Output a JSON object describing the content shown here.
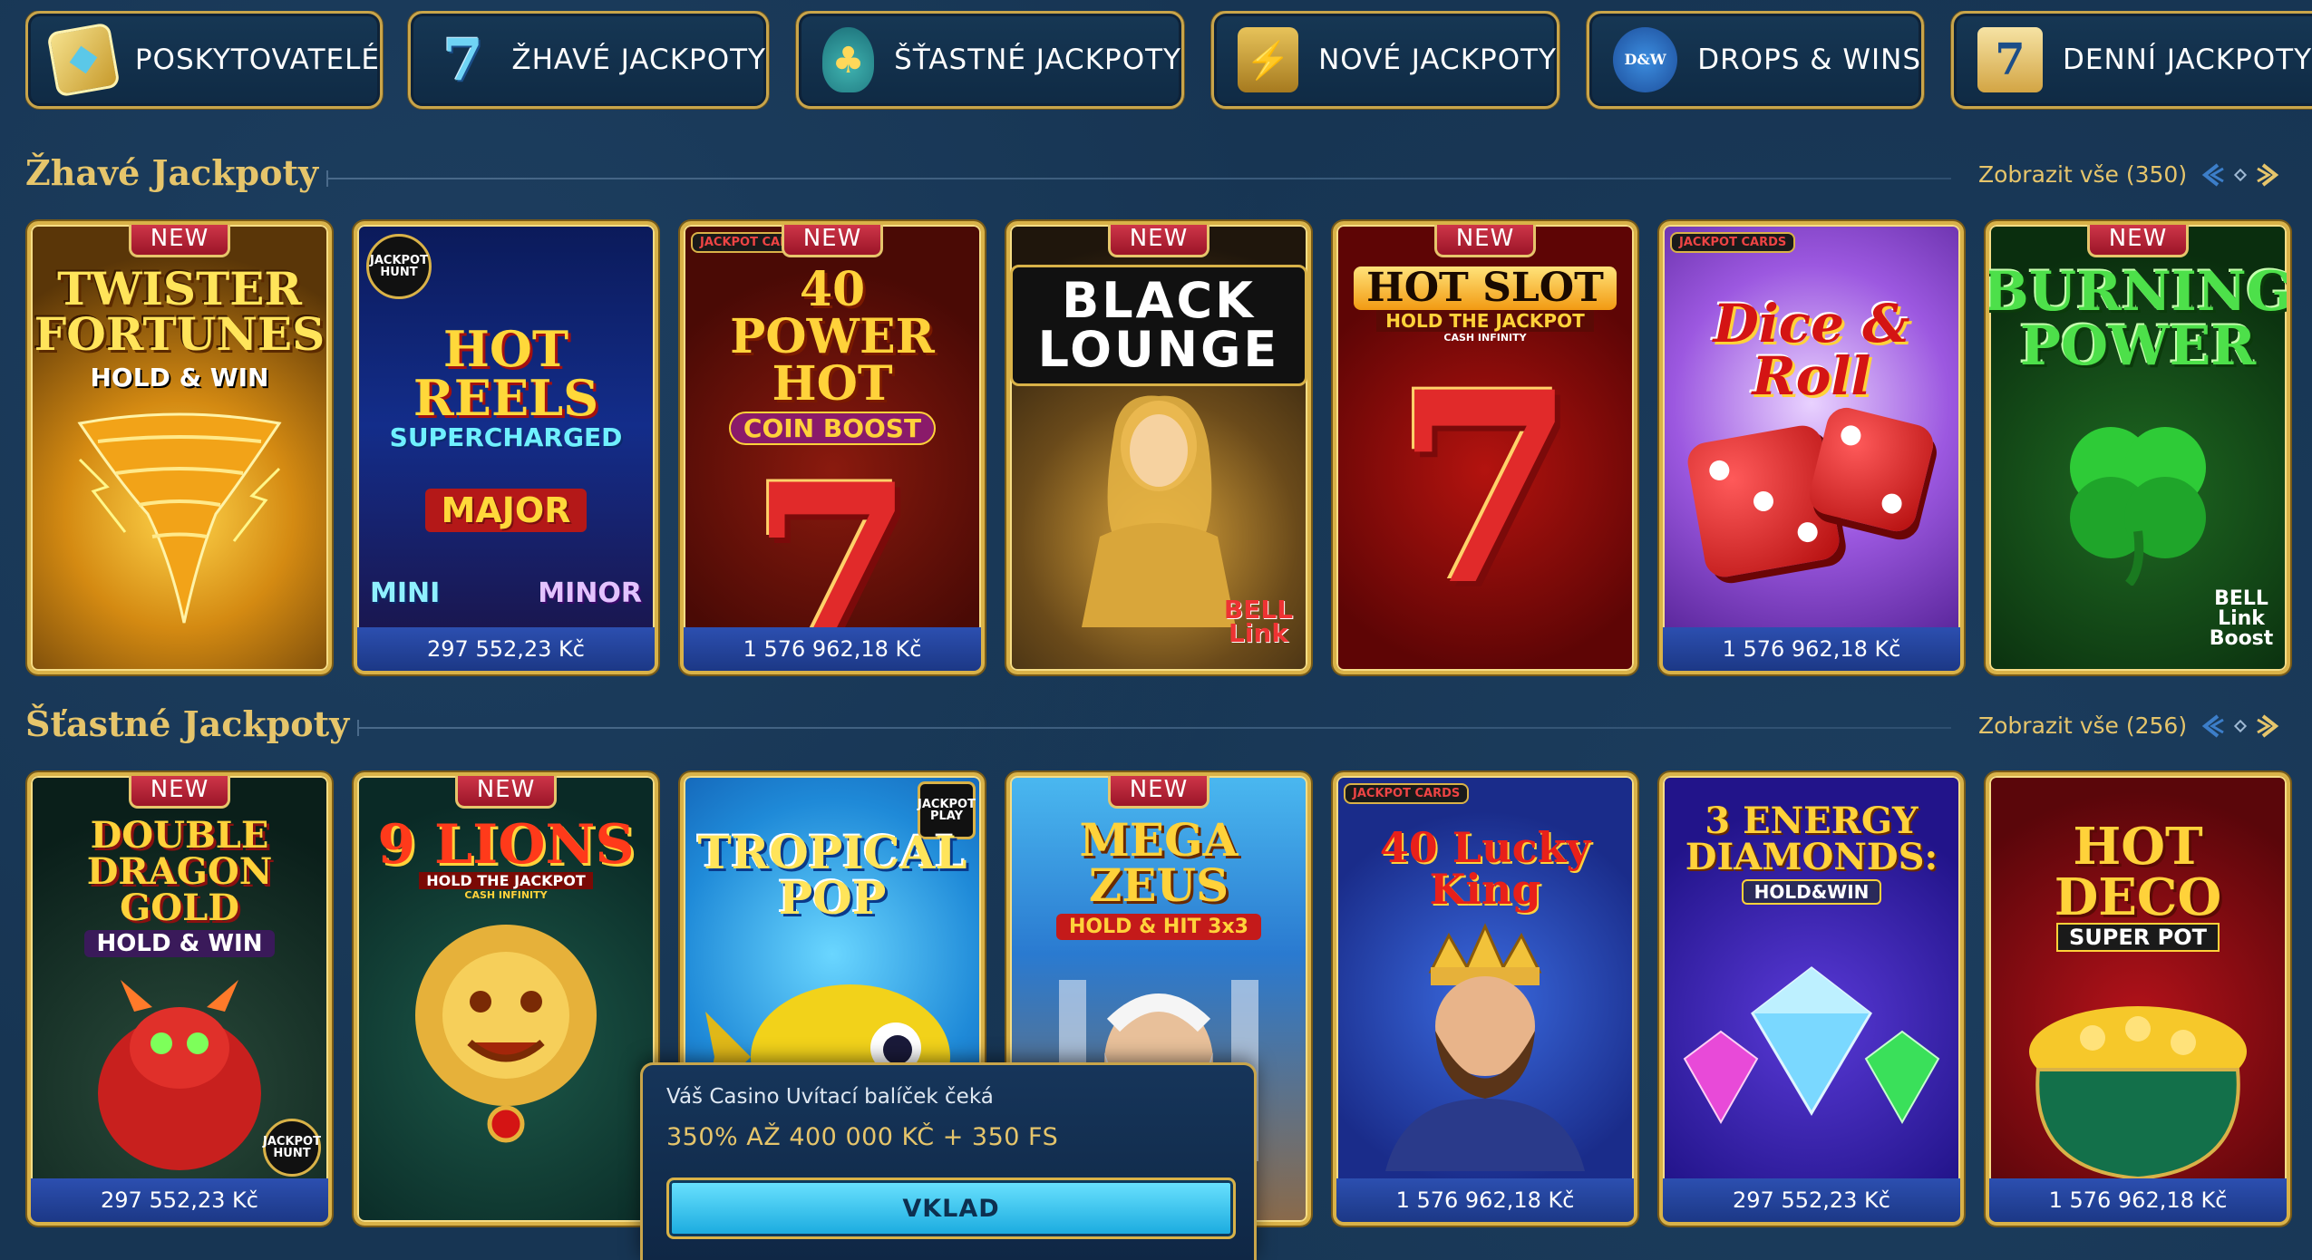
{
  "categories": [
    {
      "label": "POSKYTOVATELÉ",
      "icon": "providers-card-icon"
    },
    {
      "label": "ŽHAVÉ JACKPOTY",
      "icon": "hot-seven-icon"
    },
    {
      "label": "ŠŤASTNÉ JACKPOTY",
      "icon": "lucky-bag-icon"
    },
    {
      "label": "NOVÉ JACKPOTY",
      "icon": "treasure-chest-icon"
    },
    {
      "label": "DROPS & WINS",
      "icon": "drops-wins-icon"
    },
    {
      "label": "DENNÍ JACKPOTY",
      "icon": "calendar-seven-icon"
    }
  ],
  "sections": [
    {
      "title": "Žhavé Jackpoty",
      "view_all": "Zobrazit vše (350)",
      "games": [
        {
          "name": "TWISTER FORTUNES",
          "subtitle": "HOLD & WIN",
          "new": true,
          "prize": ""
        },
        {
          "name": "HOT REELS",
          "subtitle": "SUPERCHARGED",
          "new": false,
          "prize": "297 552,23 Kč",
          "logo": "JACKPOT HUNT",
          "art_text": [
            "MAJOR",
            "MINI",
            "MINOR"
          ]
        },
        {
          "name": "40 POWER HOT",
          "subtitle": "COIN BOOST",
          "new": true,
          "prize": "1 576 962,18 Kč",
          "logo": "JACKPOT CARDS"
        },
        {
          "name": "BLACK LOUNGE",
          "subtitle": "",
          "new": true,
          "prize": "",
          "logo": "BELL Link"
        },
        {
          "name": "HOT SLOT",
          "subtitle": "HOLD THE JACKPOT",
          "tagline": "CASH INFINITY",
          "new": true,
          "prize": ""
        },
        {
          "name": "Dice & Roll",
          "subtitle": "",
          "new": false,
          "prize": "1 576 962,18 Kč",
          "logo": "JACKPOT CARDS"
        },
        {
          "name": "BURNING POWER",
          "subtitle": "",
          "new": true,
          "prize": "",
          "logo": "BELL Link Boost"
        }
      ]
    },
    {
      "title": "Šťastné Jackpoty",
      "view_all": "Zobrazit vše (256)",
      "games": [
        {
          "name": "DOUBLE DRAGON GOLD",
          "subtitle": "HOLD & WIN",
          "new": true,
          "prize": "297 552,23 Kč",
          "logo": "JACKPOT HUNT"
        },
        {
          "name": "9 LIONS",
          "subtitle": "HOLD THE JACKPOT",
          "tagline": "CASH INFINITY",
          "new": true,
          "prize": ""
        },
        {
          "name": "TROPICAL POP",
          "subtitle": "",
          "new": false,
          "prize": "",
          "logo": "JACKPOT PLAY"
        },
        {
          "name": "MEGA ZEUS",
          "subtitle": "HOLD & HIT 3x3",
          "new": true,
          "prize": ""
        },
        {
          "name": "40 Lucky King",
          "subtitle": "",
          "new": false,
          "prize": "1 576 962,18 Kč",
          "logo": "JACKPOT CARDS"
        },
        {
          "name": "3 ENERGY DIAMONDS:",
          "subtitle": "HOLD&WIN",
          "new": false,
          "prize": "297 552,23 Kč"
        },
        {
          "name": "HOT DECO",
          "subtitle": "SUPER POT",
          "new": false,
          "prize": "1 576 962,18 Kč"
        }
      ]
    }
  ],
  "badge_new": "NEW",
  "promo": {
    "title": "Váš Casino Uvítací balíček čeká",
    "offer": "350% AŽ 400 000 KČ + 350 FS",
    "button": "VKLAD"
  },
  "colors": {
    "background": "#173553",
    "gold": "#d9b248",
    "title_gold": "#e6c56b",
    "badge_red": "#c42a3c",
    "prize_blue": "#2a4aa6",
    "cta_cyan": "#3cc7f0"
  }
}
